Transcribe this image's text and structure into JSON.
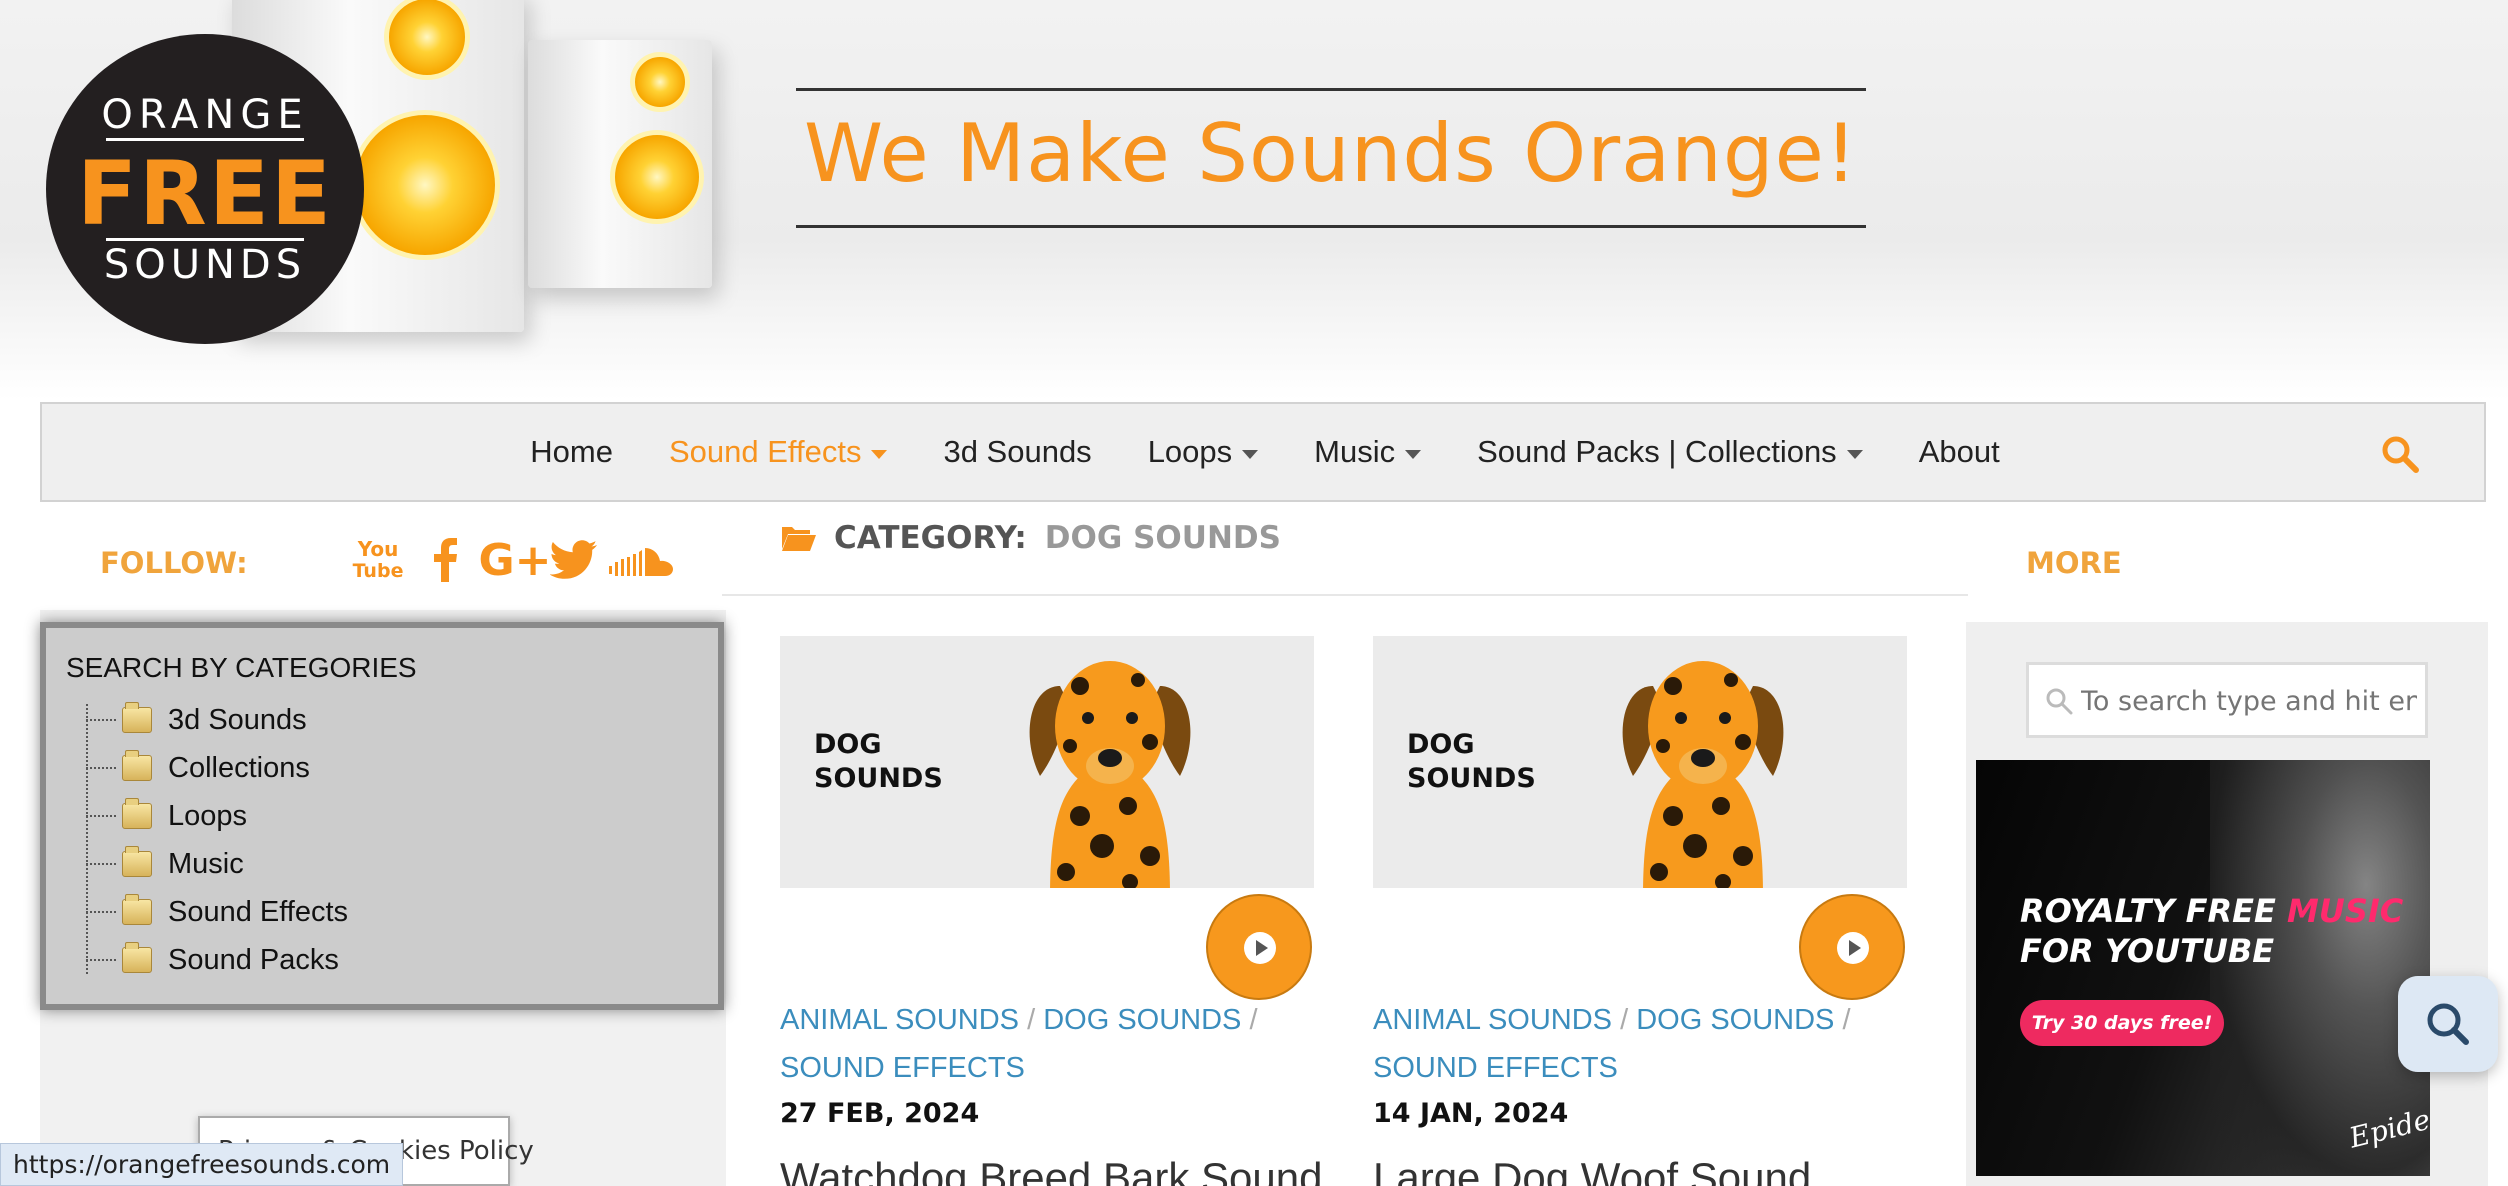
{
  "header": {
    "logo": {
      "line1": "ORANGE",
      "line2": "FREE",
      "line3": "SOUNDS"
    },
    "tagline": "We Make Sounds Orange!"
  },
  "nav": {
    "items": [
      {
        "label": "Home",
        "has_dropdown": false,
        "active": false
      },
      {
        "label": "Sound Effects",
        "has_dropdown": true,
        "active": true
      },
      {
        "label": "3d Sounds",
        "has_dropdown": false,
        "active": false
      },
      {
        "label": "Loops",
        "has_dropdown": true,
        "active": false
      },
      {
        "label": "Music",
        "has_dropdown": true,
        "active": false
      },
      {
        "label": "Sound Packs | Collections",
        "has_dropdown": true,
        "active": false
      },
      {
        "label": "About",
        "has_dropdown": false,
        "active": false
      }
    ],
    "search_icon": "search-icon"
  },
  "left_sidebar": {
    "follow_label": "FOLLOW:",
    "social_icons": [
      "youtube-icon",
      "facebook-icon",
      "google-plus-icon",
      "twitter-icon",
      "soundcloud-icon"
    ],
    "youtube_top": "You",
    "youtube_bottom": "Tube",
    "google_plus": "G+",
    "categories_title": "SEARCH BY CATEGORIES",
    "categories": [
      "3d Sounds",
      "Collections",
      "Loops",
      "Music",
      "Sound Effects",
      "Sound Packs"
    ],
    "privacy_text": "Privacy & Cookies Policy"
  },
  "status_bar": {
    "url": "https://orangefreesounds.com"
  },
  "main": {
    "category_prefix": "CATEGORY:",
    "category_name": "DOG SOUNDS",
    "posts": [
      {
        "thumb_text_line1": "DOG",
        "thumb_text_line2": "SOUNDS",
        "tags": [
          "ANIMAL SOUNDS",
          "DOG SOUNDS",
          "SOUND EFFECTS"
        ],
        "date": "27 FEB, 2024",
        "title": "Watchdog Breed Bark Sound"
      },
      {
        "thumb_text_line1": "DOG",
        "thumb_text_line2": "SOUNDS",
        "tags": [
          "ANIMAL SOUNDS",
          "DOG SOUNDS",
          "SOUND EFFECTS"
        ],
        "date": "14 JAN, 2024",
        "title": "Large Dog Woof Sound"
      }
    ]
  },
  "right_sidebar": {
    "more_label": "MORE",
    "search_placeholder": "To search type and hit enter",
    "ad": {
      "line1_white": "ROYALTY FREE ",
      "line1_pink": "MUSIC",
      "line2": "FOR YOUTUBE",
      "button": "Try 30 days free!",
      "logo": "Epidemic"
    }
  },
  "colors": {
    "accent": "#f7931e",
    "link": "#3b8dbd",
    "ad_pink": "#ee2a60"
  }
}
